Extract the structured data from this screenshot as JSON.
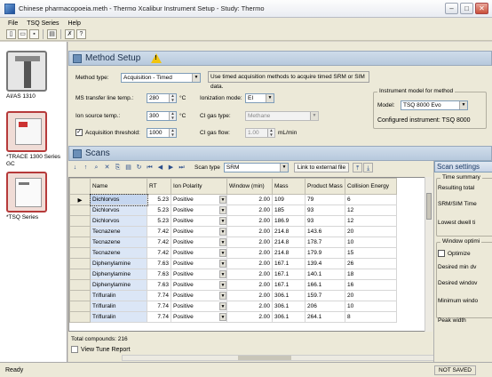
{
  "window": {
    "title": "Chinese pharmacopoeia.meth - Thermo Xcalibur Instrument Setup - Study: Thermo"
  },
  "menu": [
    "File",
    "TSQ Series",
    "Help"
  ],
  "instruments": [
    {
      "label": "AI/AS 1310",
      "icon": "autosampler-icon"
    },
    {
      "label": "*TRACE 1300 Series GC",
      "icon": "gc-instrument-icon"
    },
    {
      "label": "*TSQ Series",
      "icon": "ms-instrument-icon"
    }
  ],
  "method_setup": {
    "title": "Method Setup",
    "method_type_label": "Method type:",
    "method_type_value": "Acquisition - Timed",
    "info_text": "Use timed acquisition methods to acquire timed SRM or SIM data.",
    "ms_transfer_label": "MS transfer line temp.:",
    "ms_transfer_value": "280",
    "ion_source_label": "Ion source temp.:",
    "ion_source_value": "300",
    "unit_c": "°C",
    "acq_threshold_label": "Acquisition threshold:",
    "acq_threshold_value": "1000",
    "acq_threshold_checked": true,
    "ionization_label": "Ionization mode:",
    "ionization_value": "EI",
    "ci_gas_type_label": "CI gas type:",
    "ci_gas_type_value": "Methane",
    "ci_gas_flow_label": "CI gas flow:",
    "ci_gas_flow_value": "1.00",
    "ci_gas_flow_unit": "mL/min",
    "instrument_model_group": "Instrument model for method",
    "model_label": "Model:",
    "model_value": "TSQ 8000 Evo",
    "configured_text": "Configured instrument: TSQ 8000"
  },
  "scans": {
    "title": "Scans",
    "scan_type_label": "Scan type",
    "scan_type_value": "SRM",
    "link_label": "Link to external file",
    "columns": [
      "Name",
      "RT",
      "Ion Polarity",
      "Window (min)",
      "Mass",
      "Product Mass",
      "Collision Energy"
    ],
    "rows": [
      [
        "Dichlorvos",
        "5.23",
        "Positive",
        "2.00",
        "109",
        "79",
        "6"
      ],
      [
        "Dichlorvos",
        "5.23",
        "Positive",
        "2.00",
        "185",
        "93",
        "12"
      ],
      [
        "Dichlorvos",
        "5.23",
        "Positive",
        "2.00",
        "186.9",
        "93",
        "12"
      ],
      [
        "Tecnazene",
        "7.42",
        "Positive",
        "2.00",
        "214.8",
        "143.6",
        "20"
      ],
      [
        "Tecnazene",
        "7.42",
        "Positive",
        "2.00",
        "214.8",
        "178.7",
        "10"
      ],
      [
        "Tecnazene",
        "7.42",
        "Positive",
        "2.00",
        "214.8",
        "179.9",
        "15"
      ],
      [
        "Diphenylamine",
        "7.63",
        "Positive",
        "2.00",
        "167.1",
        "139.4",
        "26"
      ],
      [
        "Diphenylamine",
        "7.63",
        "Positive",
        "2.00",
        "167.1",
        "140.1",
        "18"
      ],
      [
        "Diphenylamine",
        "7.63",
        "Positive",
        "2.00",
        "167.1",
        "166.1",
        "16"
      ],
      [
        "Trifluralin",
        "7.74",
        "Positive",
        "2.00",
        "306.1",
        "159.7",
        "20"
      ],
      [
        "Trifluralin",
        "7.74",
        "Positive",
        "2.00",
        "306.1",
        "206",
        "10"
      ],
      [
        "Trifluralin",
        "7.74",
        "Positive",
        "2.00",
        "306.1",
        "264.1",
        "8"
      ]
    ],
    "total_compounds": "Total compounds: 216",
    "view_tune": "View Tune Report"
  },
  "scan_settings": {
    "title": "Scan settings",
    "time_summary": "Time summary",
    "resulting_total": "Resulting total",
    "srm_sim_time": "SRM/SIM Time",
    "lowest_dwell": "Lowest dwell ti",
    "window_optim": "Window optimi",
    "optimize": "Optimize",
    "desired_min": "Desired min dv",
    "desired_window": "Desired windov",
    "minimum_window": "Minimum windo",
    "peak_width": "Peak width"
  },
  "status": {
    "left": "Ready",
    "right": "NOT SAVED"
  }
}
